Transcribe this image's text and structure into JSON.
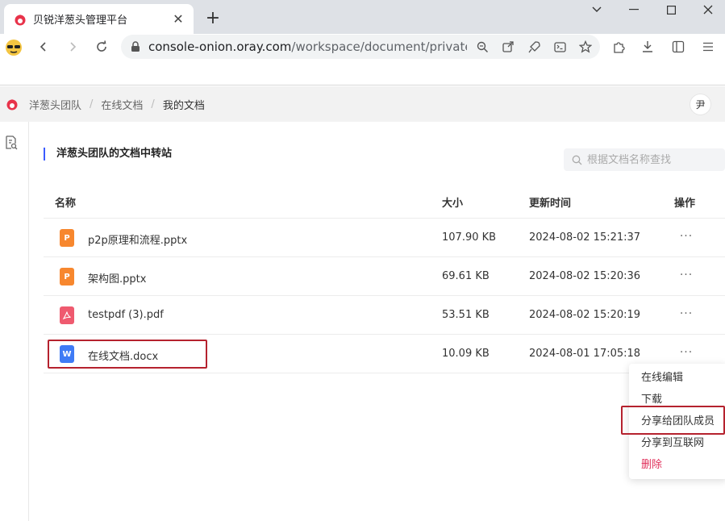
{
  "browser": {
    "tab_title": "贝锐洋葱头管理平台",
    "url_host": "console-onion.oray.com",
    "url_path": "/workspace/document/private?p..."
  },
  "app": {
    "breadcrumbs": [
      "洋葱头团队",
      "在线文档",
      "我的文档"
    ],
    "avatar_text": "尹"
  },
  "page": {
    "section_title": "洋葱头团队的文档中转站",
    "search_placeholder": "根据文档名称查找"
  },
  "table": {
    "headers": {
      "name": "名称",
      "size": "大小",
      "updated": "更新时间",
      "actions": "操作"
    },
    "rows": [
      {
        "name": "p2p原理和流程.pptx",
        "size": "107.90 KB",
        "updated": "2024-08-02 15:21:37",
        "type": "ppt",
        "icon_letter": "P",
        "more": "···"
      },
      {
        "name": "架构图.pptx",
        "size": "69.61 KB",
        "updated": "2024-08-02 15:20:36",
        "type": "ppt",
        "icon_letter": "P",
        "more": "···"
      },
      {
        "name": "testpdf (3).pdf",
        "size": "53.51 KB",
        "updated": "2024-08-02 15:20:19",
        "type": "pdf",
        "icon_letter": "",
        "more": "···"
      },
      {
        "name": "在线文档.docx",
        "size": "10.09 KB",
        "updated": "2024-08-01 17:05:18",
        "type": "doc",
        "icon_letter": "W",
        "more": "···"
      }
    ]
  },
  "context_menu": {
    "items": [
      "在线编辑",
      "下载",
      "分享给团队成员",
      "分享到互联网",
      "删除"
    ]
  },
  "colors": {
    "ppt": "#f7872e",
    "pdf": "#ef5a6f",
    "doc": "#3f7bf5",
    "accent": "#3b5bff",
    "highlight": "#b5222e"
  }
}
